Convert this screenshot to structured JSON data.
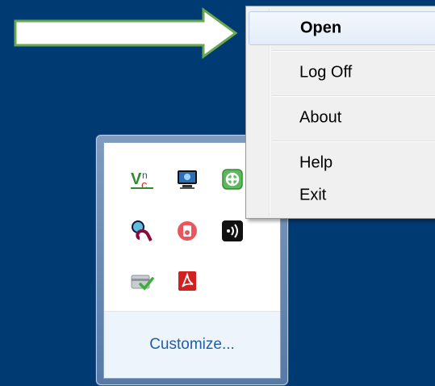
{
  "context_menu": {
    "items": [
      {
        "label": "Open",
        "bold": true
      },
      {
        "label": "Log Off"
      },
      {
        "label": "About"
      },
      {
        "label": "Help"
      },
      {
        "label": "Exit"
      }
    ]
  },
  "tray": {
    "customize_label": "Customize...",
    "icons": [
      "vnc-icon",
      "network-monitor-icon",
      "green-plus-icon",
      "audio-icon",
      "speaker-icon",
      "wifi-icon",
      "check-card-icon",
      "pdf-icon"
    ]
  },
  "colors": {
    "desktop": "#003a73",
    "arrow_border": "#6aa84f",
    "link": "#1f5ea8"
  }
}
